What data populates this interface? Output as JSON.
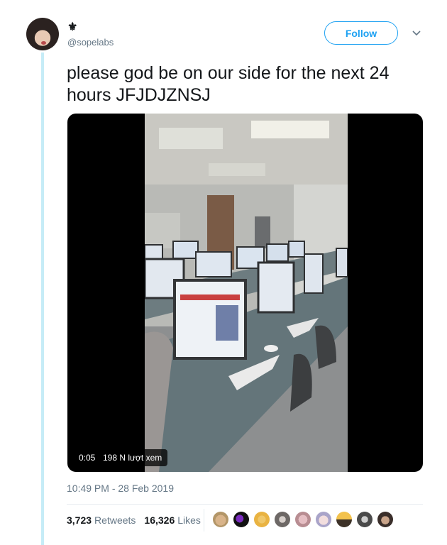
{
  "user": {
    "display_name": "⚜",
    "handle": "@sopelabs"
  },
  "follow_label": "Follow",
  "tweet": {
    "text": "please god be on our side for the next 24 hours JFJDJZNSJ"
  },
  "video": {
    "time": "0:05",
    "views": "198 N lượt xem"
  },
  "timestamp": "10:49 PM - 28 Feb 2019",
  "stats": {
    "retweets_count": "3,723",
    "retweets_label": "Retweets",
    "likes_count": "16,326",
    "likes_label": "Likes"
  },
  "colors": {
    "accent": "#1da1f2",
    "thread_line": "#c6ecf7",
    "muted": "#657786"
  }
}
